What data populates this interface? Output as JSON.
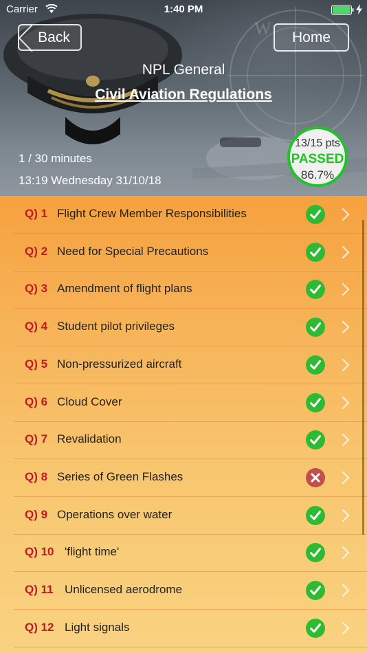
{
  "status_bar": {
    "carrier": "Carrier",
    "time": "1:40 PM",
    "icons": [
      "wifi-icon",
      "battery-icon",
      "bolt-icon"
    ]
  },
  "nav": {
    "back_label": "Back",
    "home_label": "Home"
  },
  "quiz": {
    "title": "NPL General",
    "subtitle": "Civil Aviation Regulations",
    "time_info": "1 / 30 minutes",
    "date_info": "13:19 Wednesday 31/10/18"
  },
  "score": {
    "points": "13/15 pts",
    "status": "PASSED",
    "percent": "86.7%"
  },
  "colors": {
    "pass": "#2fba33",
    "fail": "#c0504d",
    "question_number": "#c01826",
    "badge_border": "#22c22a"
  },
  "questions": [
    {
      "num": "Q) 1",
      "text": "Flight Crew Member Responsibilities",
      "result": "correct"
    },
    {
      "num": "Q) 2",
      "text": "Need for Special Precautions",
      "result": "correct"
    },
    {
      "num": "Q) 3",
      "text": "Amendment of flight plans",
      "result": "correct"
    },
    {
      "num": "Q) 4",
      "text": "Student pilot privileges",
      "result": "correct"
    },
    {
      "num": "Q) 5",
      "text": "Non-pressurized aircraft",
      "result": "correct"
    },
    {
      "num": "Q) 6",
      "text": "Cloud Cover",
      "result": "correct"
    },
    {
      "num": "Q) 7",
      "text": "Revalidation",
      "result": "correct"
    },
    {
      "num": "Q) 8",
      "text": "Series of Green Flashes",
      "result": "incorrect"
    },
    {
      "num": "Q) 9",
      "text": "Operations over water",
      "result": "correct"
    },
    {
      "num": "Q) 10",
      "text": "'flight time'",
      "result": "correct"
    },
    {
      "num": "Q) 11",
      "text": "Unlicensed aerodrome",
      "result": "correct"
    },
    {
      "num": "Q) 12",
      "text": "Light signals",
      "result": "correct"
    }
  ]
}
